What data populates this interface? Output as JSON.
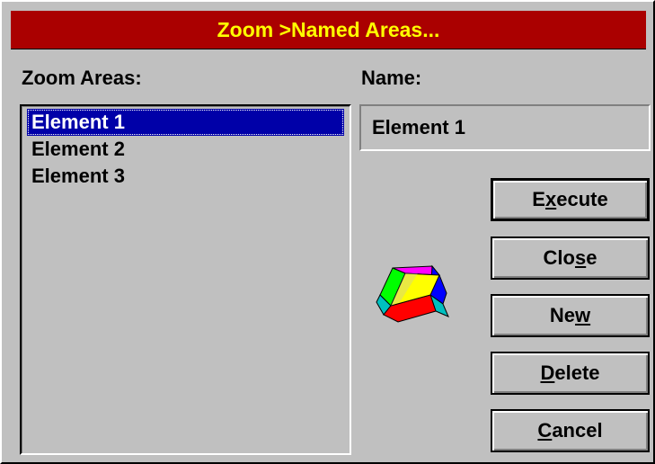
{
  "dialog": {
    "title": "Zoom >Named Areas...",
    "zoom_areas_label": "Zoom Areas:",
    "name_label": "Name:",
    "name_value": "Element 1"
  },
  "zoom_areas": [
    {
      "label": "Element 1",
      "selected": true
    },
    {
      "label": "Element 2",
      "selected": false
    },
    {
      "label": "Element 3",
      "selected": false
    }
  ],
  "buttons": {
    "execute": {
      "pre": "E",
      "key": "x",
      "post": "ecute"
    },
    "close": {
      "pre": "Clo",
      "key": "s",
      "post": "e"
    },
    "new": {
      "pre": "Ne",
      "key": "w",
      "post": ""
    },
    "delete": {
      "pre": "",
      "key": "D",
      "post": "elete"
    },
    "cancel": {
      "pre": "",
      "key": "C",
      "post": "ancel"
    }
  },
  "colors": {
    "title_bg": "#aa0000",
    "title_text": "#ffff00",
    "selection_bg": "#0000a8"
  },
  "icons": {
    "zoom": "zoom-cube-icon"
  }
}
